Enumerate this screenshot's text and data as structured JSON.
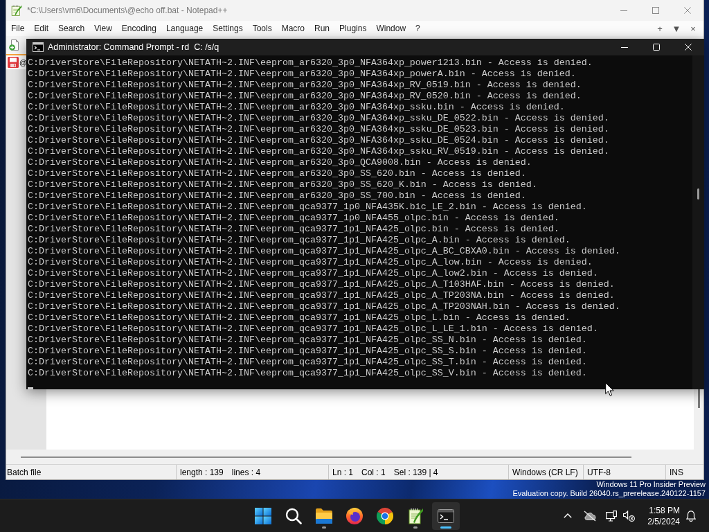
{
  "notepad": {
    "title": "*C:\\Users\\vm6\\Documents\\@echo off.bat - Notepad++",
    "menu": [
      "File",
      "Edit",
      "Search",
      "View",
      "Encoding",
      "Language",
      "Settings",
      "Tools",
      "Macro",
      "Run",
      "Plugins",
      "Window",
      "?"
    ],
    "menu_right": [
      "+",
      "▼",
      "×"
    ],
    "tab": {
      "label": "@",
      "modified": true
    },
    "status_bar": {
      "sections": [
        [
          "Batch file"
        ],
        [
          "length : 139",
          "lines : 4"
        ],
        [
          "Ln : 1",
          "Col : 1",
          "Sel : 139 | 4"
        ],
        [
          "Windows (CR LF)"
        ],
        [
          "UTF-8"
        ],
        [
          "INS"
        ]
      ]
    }
  },
  "cmd": {
    "title": "Administrator: Command Prompt - rd  C: /s/q",
    "lines": [
      "C:DriverStore\\FileRepository\\NETATH~2.INF\\eeprom_ar6320_3p0_NFA364xp_power1213.bin - Access is denied.",
      "C:DriverStore\\FileRepository\\NETATH~2.INF\\eeprom_ar6320_3p0_NFA364xp_powerA.bin - Access is denied.",
      "C:DriverStore\\FileRepository\\NETATH~2.INF\\eeprom_ar6320_3p0_NFA364xp_RV_0519.bin - Access is denied.",
      "C:DriverStore\\FileRepository\\NETATH~2.INF\\eeprom_ar6320_3p0_NFA364xp_RV_0520.bin - Access is denied.",
      "C:DriverStore\\FileRepository\\NETATH~2.INF\\eeprom_ar6320_3p0_NFA364xp_ssku.bin - Access is denied.",
      "C:DriverStore\\FileRepository\\NETATH~2.INF\\eeprom_ar6320_3p0_NFA364xp_ssku_DE_0522.bin - Access is denied.",
      "C:DriverStore\\FileRepository\\NETATH~2.INF\\eeprom_ar6320_3p0_NFA364xp_ssku_DE_0523.bin - Access is denied.",
      "C:DriverStore\\FileRepository\\NETATH~2.INF\\eeprom_ar6320_3p0_NFA364xp_ssku_DE_0524.bin - Access is denied.",
      "C:DriverStore\\FileRepository\\NETATH~2.INF\\eeprom_ar6320_3p0_NFA364xp_ssku_RV_0519.bin - Access is denied.",
      "C:DriverStore\\FileRepository\\NETATH~2.INF\\eeprom_ar6320_3p0_QCA9008.bin - Access is denied.",
      "C:DriverStore\\FileRepository\\NETATH~2.INF\\eeprom_ar6320_3p0_SS_620.bin - Access is denied.",
      "C:DriverStore\\FileRepository\\NETATH~2.INF\\eeprom_ar6320_3p0_SS_620_K.bin - Access is denied.",
      "C:DriverStore\\FileRepository\\NETATH~2.INF\\eeprom_ar6320_3p0_SS_700.bin - Access is denied.",
      "C:DriverStore\\FileRepository\\NETATH~2.INF\\eeprom_qca9377_1p0_NFA435K.bic_LE_2.bin - Access is denied.",
      "C:DriverStore\\FileRepository\\NETATH~2.INF\\eeprom_qca9377_1p0_NFA455_olpc.bin - Access is denied.",
      "C:DriverStore\\FileRepository\\NETATH~2.INF\\eeprom_qca9377_1p1_NFA425_olpc.bin - Access is denied.",
      "C:DriverStore\\FileRepository\\NETATH~2.INF\\eeprom_qca9377_1p1_NFA425_olpc_A.bin - Access is denied.",
      "C:DriverStore\\FileRepository\\NETATH~2.INF\\eeprom_qca9377_1p1_NFA425_olpc_A_BC_CBXA0.bin - Access is denied.",
      "C:DriverStore\\FileRepository\\NETATH~2.INF\\eeprom_qca9377_1p1_NFA425_olpc_A_low.bin - Access is denied.",
      "C:DriverStore\\FileRepository\\NETATH~2.INF\\eeprom_qca9377_1p1_NFA425_olpc_A_low2.bin - Access is denied.",
      "C:DriverStore\\FileRepository\\NETATH~2.INF\\eeprom_qca9377_1p1_NFA425_olpc_A_T103HAF.bin - Access is denied.",
      "C:DriverStore\\FileRepository\\NETATH~2.INF\\eeprom_qca9377_1p1_NFA425_olpc_A_TP203NA.bin - Access is denied.",
      "C:DriverStore\\FileRepository\\NETATH~2.INF\\eeprom_qca9377_1p1_NFA425_olpc_A_TP203NAH.bin - Access is denied.",
      "C:DriverStore\\FileRepository\\NETATH~2.INF\\eeprom_qca9377_1p1_NFA425_olpc_L.bin - Access is denied.",
      "C:DriverStore\\FileRepository\\NETATH~2.INF\\eeprom_qca9377_1p1_NFA425_olpc_L_LE_1.bin - Access is denied.",
      "C:DriverStore\\FileRepository\\NETATH~2.INF\\eeprom_qca9377_1p1_NFA425_olpc_SS_N.bin - Access is denied.",
      "C:DriverStore\\FileRepository\\NETATH~2.INF\\eeprom_qca9377_1p1_NFA425_olpc_SS_S.bin - Access is denied.",
      "C:DriverStore\\FileRepository\\NETATH~2.INF\\eeprom_qca9377_1p1_NFA425_olpc_SS_T.bin - Access is denied.",
      "C:DriverStore\\FileRepository\\NETATH~2.INF\\eeprom_qca9377_1p1_NFA425_olpc_SS_V.bin - Access is denied."
    ]
  },
  "desktop": {
    "watermark": [
      "Windows 11 Pro Insider Preview",
      "Evaluation copy. Build 26040.rs_prerelease.240122-1157"
    ]
  },
  "taskbar": {
    "apps": [
      {
        "kind": "start",
        "running": false,
        "selected": false
      },
      {
        "kind": "search",
        "running": false,
        "selected": false
      },
      {
        "kind": "folder",
        "running": true,
        "selected": false
      },
      {
        "kind": "flame",
        "running": false,
        "selected": false
      },
      {
        "kind": "wheel",
        "running": false,
        "selected": false
      },
      {
        "kind": "notepad",
        "running": true,
        "selected": false
      },
      {
        "kind": "terminal",
        "running": true,
        "selected": true
      }
    ],
    "clock": {
      "time": "1:58 PM",
      "date": "2/5/2024"
    }
  }
}
